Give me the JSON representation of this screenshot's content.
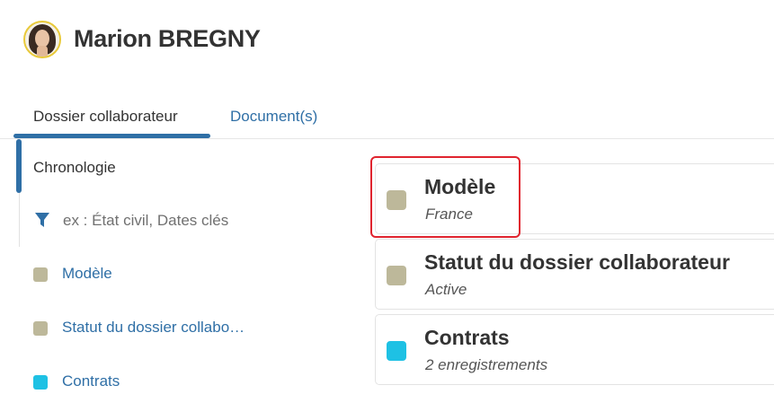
{
  "user": {
    "name": "Marion BREGNY"
  },
  "tabs": [
    {
      "label": "Dossier collaborateur",
      "active": true
    },
    {
      "label": "Document(s)",
      "active": false
    }
  ],
  "sidebar": {
    "title": "Chronologie",
    "filter_placeholder": "ex : État civil, Dates clés",
    "items": [
      {
        "label": "Modèle",
        "color": "#bdb89a"
      },
      {
        "label": "Statut du dossier collabo…",
        "color": "#bdb89a"
      },
      {
        "label": "Contrats",
        "color": "#1ec1e4"
      }
    ]
  },
  "cards": [
    {
      "title": "Modèle",
      "subtitle": "France",
      "color": "#bdb89a"
    },
    {
      "title": "Statut du dossier collaborateur",
      "subtitle": "Active",
      "color": "#bdb89a"
    },
    {
      "title": "Contrats",
      "subtitle": "2  enregistrements",
      "color": "#1ec1e4"
    }
  ],
  "colors": {
    "accent": "#2f6fa6",
    "highlight": "#e0242f"
  }
}
